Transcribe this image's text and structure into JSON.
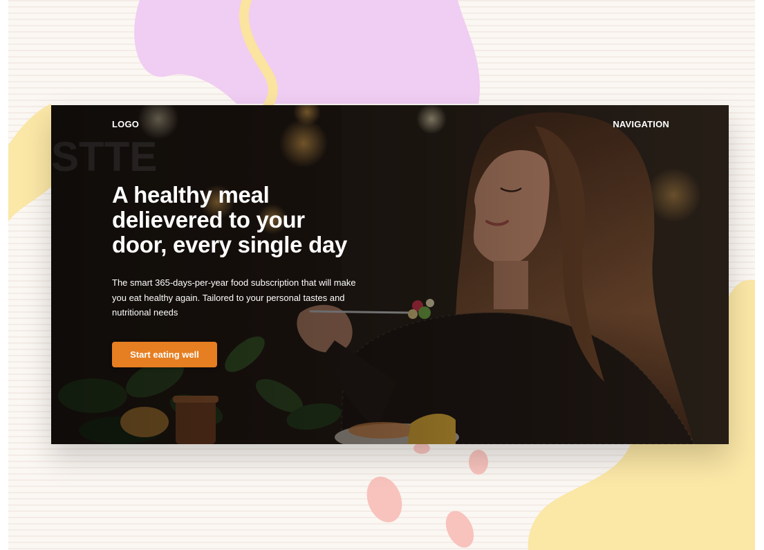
{
  "header": {
    "logo": "LOGO",
    "navigation": "NAVIGATION"
  },
  "hero": {
    "headline_lines": [
      "A healthy meal",
      "delievered to your",
      "door, every single day"
    ],
    "subtext_lines": [
      "The smart 365-days-per-year food subscription that will make",
      "you eat healthy again. Tailored to your personal tastes and",
      "nutritional needs"
    ],
    "cta_label": "Start eating well"
  },
  "colors": {
    "accent": "#e67e22",
    "text": "#ffffff",
    "background": "#fbf7f3",
    "blob_purple": "#f0cdf3",
    "blob_yellow": "#fbe7a6",
    "blob_pink": "#f8c3bd"
  }
}
